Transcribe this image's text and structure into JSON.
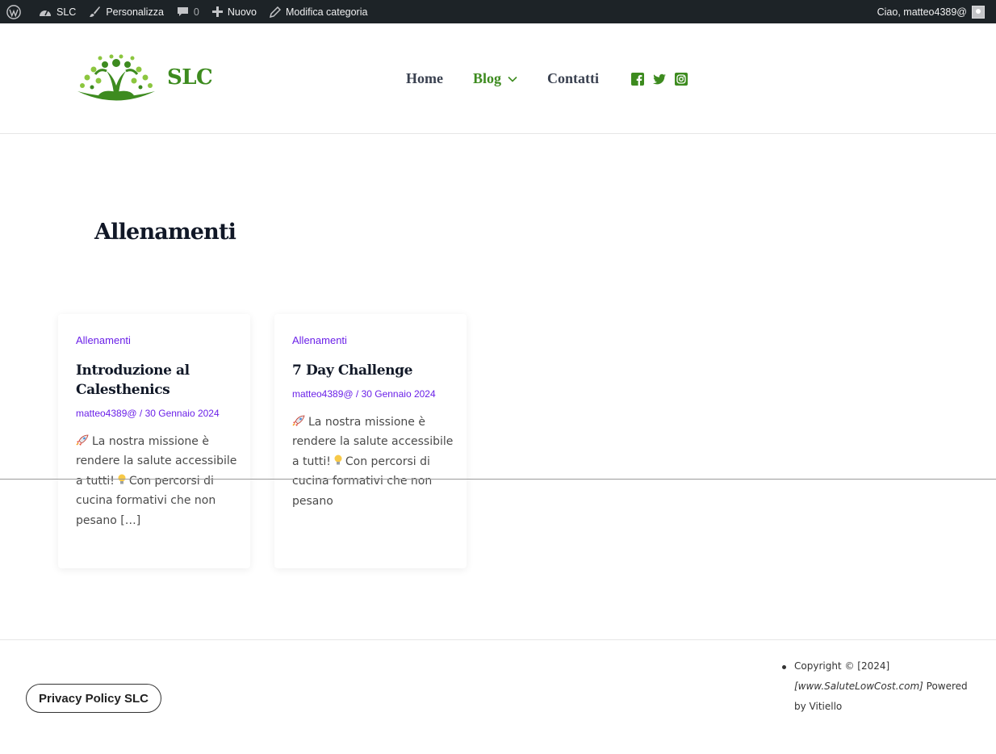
{
  "adminbar": {
    "wp_icon": "wordpress-logo-icon",
    "site_name": "SLC",
    "customize": "Personalizza",
    "comments_count": "0",
    "new": "Nuovo",
    "edit_category": "Modifica categoria",
    "greeting": "Ciao, matteo4389@"
  },
  "header": {
    "site_title": "SLC",
    "nav": [
      {
        "label": "Home"
      },
      {
        "label": "Blog"
      },
      {
        "label": "Contatti"
      }
    ],
    "social": [
      "facebook-icon",
      "twitter-icon",
      "instagram-icon"
    ]
  },
  "category": {
    "title": "Allenamenti"
  },
  "posts": [
    {
      "category": "Allenamenti",
      "title": "Introduzione al Calesthenics",
      "meta": "matteo4389@ / 30 Gennaio 2024",
      "excerpt_a": "La nostra missione è rendere la salute accessibile a tutti!",
      "excerpt_b": "Con percorsi di cucina formativi che non pesano […]"
    },
    {
      "category": "Allenamenti",
      "title": "7 Day Challenge",
      "meta": "matteo4389@ / 30 Gennaio 2024",
      "excerpt_a": "La nostra missione è rendere la salute accessibile a tutti!",
      "excerpt_b": "Con percorsi di cucina formativi che non pesano"
    }
  ],
  "footer": {
    "privacy": "Privacy Policy SLC",
    "copyright_a": "Copyright © [2024]",
    "copyright_site": "[www.SaluteLowCost.com]",
    "copyright_b": "Powered by Vitiello"
  },
  "colors": {
    "brand_green": "#3d8b1f",
    "accent_purple": "#6b21e8",
    "adminbar_bg": "#1d2327"
  }
}
